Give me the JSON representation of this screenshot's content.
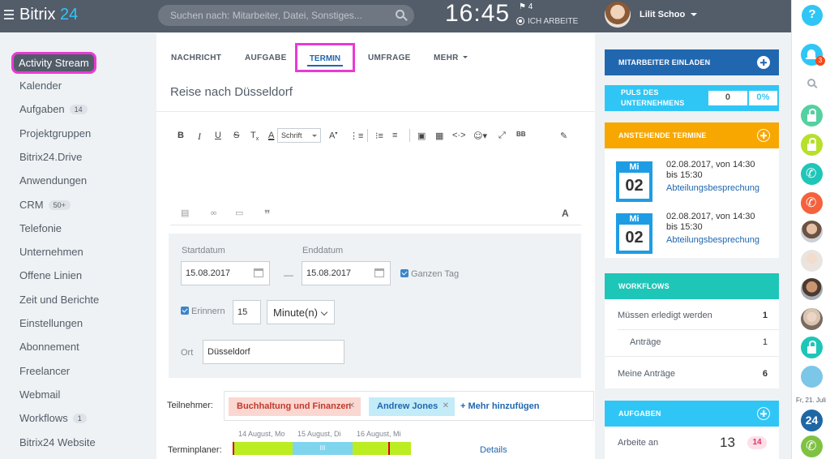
{
  "header": {
    "logo_name": "Bitrix",
    "logo_num": "24",
    "search_placeholder": "Suchen nach: Mitarbeiter, Datei, Sonstiges...",
    "clock": "16:45",
    "flag_count": "4",
    "work_status": "ICH ARBEITE",
    "user_name": "Lilit Schoo"
  },
  "sidebar": {
    "active": "Activity Stream",
    "items": [
      {
        "label": "Kalender",
        "count": ""
      },
      {
        "label": "Aufgaben",
        "count": "14"
      },
      {
        "label": "Projektgruppen",
        "count": ""
      },
      {
        "label": "Bitrix24.Drive",
        "count": ""
      },
      {
        "label": "Anwendungen",
        "count": ""
      },
      {
        "label": "CRM",
        "count": "50+"
      },
      {
        "label": "Telefonie",
        "count": ""
      },
      {
        "label": "Unternehmen",
        "count": ""
      },
      {
        "label": "Offene Linien",
        "count": ""
      },
      {
        "label": "Zeit und Berichte",
        "count": ""
      },
      {
        "label": "Einstellungen",
        "count": ""
      },
      {
        "label": "Abonnement",
        "count": ""
      },
      {
        "label": "Freelancer",
        "count": ""
      },
      {
        "label": "Webmail",
        "count": ""
      },
      {
        "label": "Workflows",
        "count": "1"
      },
      {
        "label": "Bitrix24 Website",
        "count": ""
      }
    ]
  },
  "tabs": {
    "nachricht": "NACHRICHT",
    "aufgabe": "AUFGABE",
    "termin": "TERMIN",
    "umfrage": "UMFRAGE",
    "mehr": "MEHR"
  },
  "form": {
    "subject": "Reise nach Düsseldorf",
    "font_select": "Schrift",
    "start_label": "Startdatum",
    "start_value": "15.08.2017",
    "end_label": "Enddatum",
    "end_value": "15.08.2017",
    "dash": "—",
    "allday": "Ganzen Tag",
    "remind": "Erinnern",
    "remind_value": "15",
    "remind_unit": "Minute(n)",
    "location_label": "Ort",
    "location_value": "Düsseldorf",
    "participants_label": "Teilnehmer:",
    "participants": [
      "Buchhaltung und Finanzen",
      "Andrew Jones"
    ],
    "add_more": "+ Mehr hinzufügen",
    "planner_label": "Terminplaner:",
    "planner_dates": [
      "14 August, Mo",
      "15 August, Di",
      "16 August, Mi"
    ],
    "planner_mid": "III",
    "details": "Details"
  },
  "right": {
    "invite": "MITARBEITER EINLADEN",
    "pulse": "PULS DES UNTERNEHMENS",
    "pulse_value": "0",
    "pulse_pct": "0%",
    "events_title": "ANSTEHENDE TERMINE",
    "events": [
      {
        "month": "Mi",
        "day": "02",
        "time1": "02.08.2017, von 14:30",
        "time2": "bis 15:30",
        "title": "Abteilungsbesprechung"
      },
      {
        "month": "Mi",
        "day": "02",
        "time1": "02.08.2017, von 14:30",
        "time2": "bis 15:30",
        "title": "Abteilungsbesprechung"
      }
    ],
    "workflows_title": "WORKFLOWS",
    "workflows": [
      {
        "label": "Müssen erledigt werden",
        "value": "1"
      },
      {
        "label": "Anträge",
        "value": "1"
      },
      {
        "label": "Meine Anträge",
        "value": "6"
      }
    ],
    "tasks_title": "AUFGABEN",
    "tasks_label": "Arbeite an",
    "tasks_count": "13",
    "tasks_badge": "14"
  },
  "rightbar": {
    "help": "?",
    "notif_count": "3",
    "date": "Fr, 21. Juli",
    "b24": "24"
  },
  "colors": {
    "topbar": "#535c69",
    "accent": "#2fc6f6",
    "highlight": "#ea3ad4",
    "invite": "#2067b0",
    "events": "#f7a700",
    "workflows": "#1ec6b8"
  }
}
